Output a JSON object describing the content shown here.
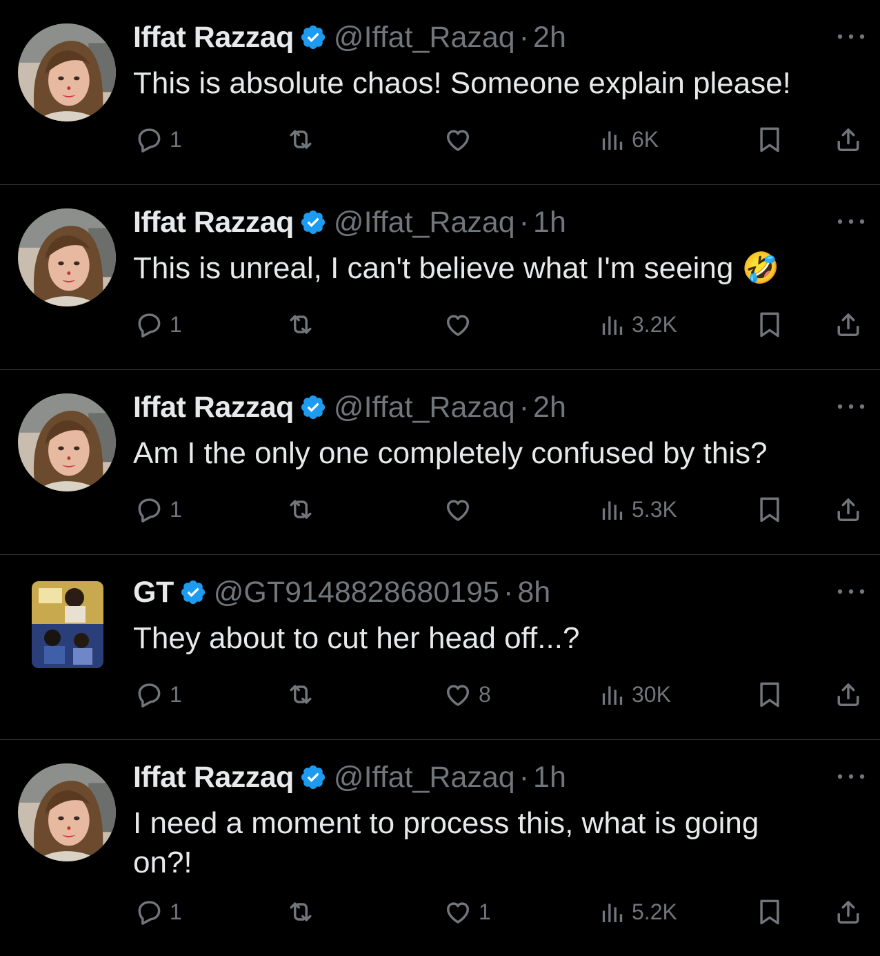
{
  "colors": {
    "background": "#000000",
    "text_primary": "#e7e9ea",
    "text_secondary": "#71767b",
    "divider": "#2f3336",
    "verified_badge": "#1d9bf0"
  },
  "tweets": [
    {
      "name": "Iffat Razzaq",
      "verified": true,
      "handle": "@Iffat_Razaq",
      "separator": "·",
      "time": "2h",
      "text": "This is absolute chaos! Someone explain please!",
      "emoji": "",
      "reply_count": "1",
      "retweet_count": "",
      "like_count": "",
      "views": "6K",
      "avatar_icon": "profile-photo",
      "more_icon": "ellipsis-icon"
    },
    {
      "name": "Iffat Razzaq",
      "verified": true,
      "handle": "@Iffat_Razaq",
      "separator": "·",
      "time": "1h",
      "text": "This is unreal, I can't believe what I'm seeing ",
      "emoji": "🤣",
      "reply_count": "1",
      "retweet_count": "",
      "like_count": "",
      "views": "3.2K",
      "avatar_icon": "profile-photo",
      "more_icon": "ellipsis-icon"
    },
    {
      "name": "Iffat Razzaq",
      "verified": true,
      "handle": "@Iffat_Razaq",
      "separator": "·",
      "time": "2h",
      "text": "Am I the only one completely confused by this?",
      "emoji": "",
      "reply_count": "1",
      "retweet_count": "",
      "like_count": "",
      "views": "5.3K",
      "avatar_icon": "profile-photo",
      "more_icon": "ellipsis-icon"
    },
    {
      "name": "GT",
      "verified": true,
      "handle": "@GT9148828680195",
      "separator": "·",
      "time": "8h",
      "text": "They about to cut her head off...?",
      "emoji": "",
      "reply_count": "1",
      "retweet_count": "",
      "like_count": "8",
      "views": "30K",
      "avatar_icon": "anime-collage-avatar",
      "more_icon": "ellipsis-icon"
    },
    {
      "name": "Iffat Razzaq",
      "verified": true,
      "handle": "@Iffat_Razaq",
      "separator": "·",
      "time": "1h",
      "text": "I need a moment to process this, what is going\non?!",
      "emoji": "",
      "reply_count": "1",
      "retweet_count": "",
      "like_count": "1",
      "views": "5.2K",
      "avatar_icon": "profile-photo",
      "more_icon": "ellipsis-icon"
    }
  ]
}
